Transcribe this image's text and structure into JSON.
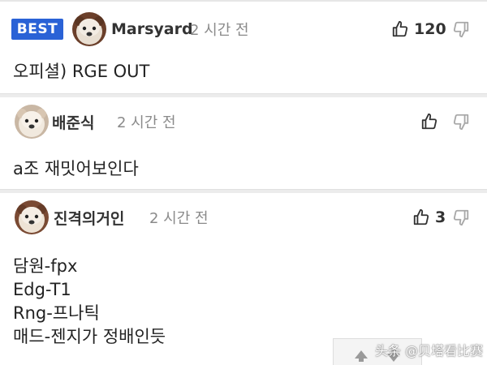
{
  "comments": [
    {
      "badge": "BEST",
      "author": "Marsyard",
      "time": "2 시간 전",
      "likes": "120",
      "body": "오피셜) RGE OUT"
    },
    {
      "author": "배준식",
      "time": "2 시간 전",
      "likes": "",
      "body": "a조 재밋어보인다"
    },
    {
      "author": "진격의거인",
      "time": "2 시간 전",
      "likes": "3",
      "body_lines": [
        "담원-fpx",
        "Edg-T1",
        "Rng-프나틱",
        "매드-젠지가 정배인듯"
      ]
    }
  ],
  "watermark": "头条 @贝塔看比赛",
  "icons": {
    "like": "thumbs-up-icon",
    "dislike": "thumbs-down-icon",
    "scroll_up": "arrow-up-icon",
    "scroll_down": "arrow-down-icon"
  },
  "colors": {
    "best_badge": "#2a62d6",
    "text": "#222222",
    "muted": "#8a8a8a",
    "divider": "#ececec"
  }
}
